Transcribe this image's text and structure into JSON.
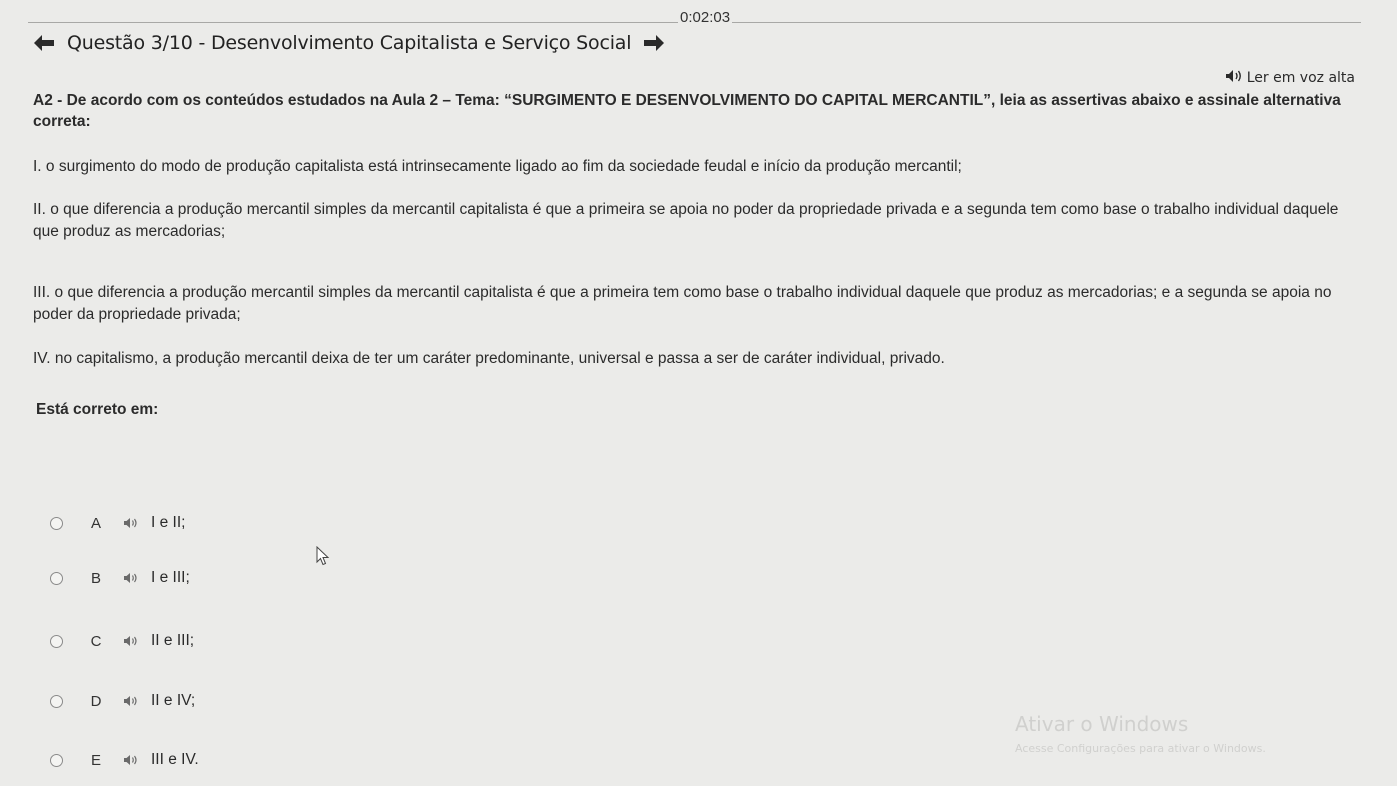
{
  "timer": "0:02:03",
  "header": {
    "title": "Questão 3/10 - Desenvolvimento Capitalista e Serviço Social"
  },
  "read_aloud": {
    "label": "Ler em voz alta"
  },
  "question": {
    "text": "A2 - De acordo com os conteúdos estudados na Aula 2 – Tema: “SURGIMENTO E DESENVOLVIMENTO DO CAPITAL MERCANTIL”, leia as assertivas abaixo e assinale alternativa correta:"
  },
  "statements": [
    "I. o surgimento do modo de produção capitalista está intrinsecamente ligado ao fim da sociedade feudal e início da produção mercantil;",
    "II. o que diferencia a produção mercantil simples da mercantil capitalista é que a primeira se apoia no poder da propriedade privada e a segunda tem como base o trabalho individual daquele que produz as mercadorias;",
    "III. o que diferencia a produção mercantil simples da mercantil capitalista é que a primeira tem como base o trabalho individual daquele que produz as mercadorias; e a segunda se apoia no poder da propriedade privada;",
    "IV. no capitalismo, a produção mercantil deixa de ter um caráter predominante, universal e passa a ser de caráter individual, privado."
  ],
  "prompt": "Está correto em:",
  "options": [
    {
      "letter": "A",
      "text": "I e II;"
    },
    {
      "letter": "B",
      "text": "I e III;"
    },
    {
      "letter": "C",
      "text": "II e III;"
    },
    {
      "letter": "D",
      "text": "II e IV;"
    },
    {
      "letter": "E",
      "text": "III e IV."
    }
  ],
  "watermark": {
    "title": "Ativar o Windows",
    "subtitle": "Acesse Configurações para ativar o Windows."
  },
  "icons": {
    "prev": "arrow-left-icon",
    "next": "arrow-right-icon",
    "audio": "speaker-icon",
    "cursor": "mouse-pointer-icon"
  }
}
